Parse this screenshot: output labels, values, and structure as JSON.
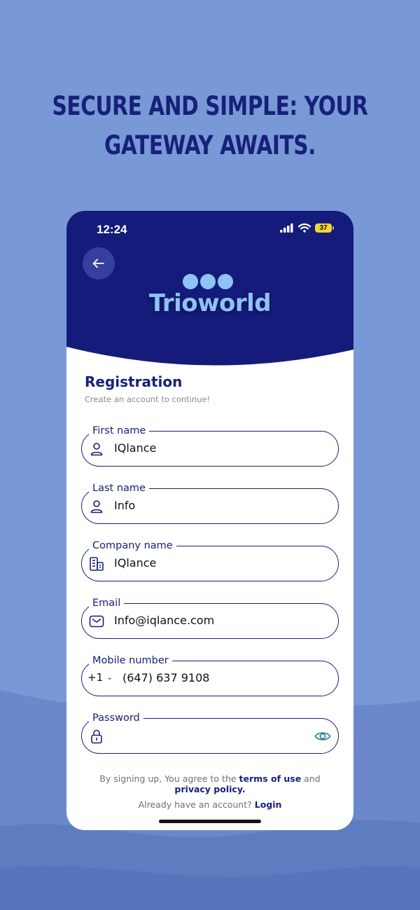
{
  "headline": {
    "line1": "SECURE AND SIMPLE: YOUR",
    "line2": "GATEWAY AWAITS."
  },
  "status_bar": {
    "time": "12:24",
    "battery": "37",
    "icons": [
      "signal-icon",
      "wifi-icon",
      "battery-icon"
    ]
  },
  "header": {
    "back_icon": "arrow-left-icon",
    "logo_text": "Trioworld",
    "colors": {
      "header_bg": "#151b7a",
      "logo": "#8ec3f3"
    }
  },
  "registration": {
    "title": "Registration",
    "subtitle": "Create an account to continue!"
  },
  "form": {
    "first_name": {
      "label": "First name",
      "value": "IQlance",
      "icon": "user-icon"
    },
    "last_name": {
      "label": "Last name",
      "value": "Info",
      "icon": "user-icon"
    },
    "company_name": {
      "label": "Company name",
      "value": "IQlance",
      "icon": "building-icon"
    },
    "email": {
      "label": "Email",
      "value": "Info@iqlance.com",
      "icon": "mail-icon"
    },
    "mobile": {
      "label": "Mobile number",
      "country_code": "+1",
      "value": "(647) 637 9108"
    },
    "password": {
      "label": "Password",
      "value": "",
      "icon": "lock-icon",
      "toggle_icon": "eye-icon"
    }
  },
  "footer": {
    "terms_prefix": "By signing up, You agree to the ",
    "terms_link": "terms of use",
    "terms_and": " and",
    "privacy_link": "privacy policy.",
    "login_prefix": "Already have an account? ",
    "login_link": "Login"
  },
  "colors": {
    "page_bg": "#7899d6",
    "accent": "#17207a",
    "eye_icon": "#1f7a8a"
  }
}
